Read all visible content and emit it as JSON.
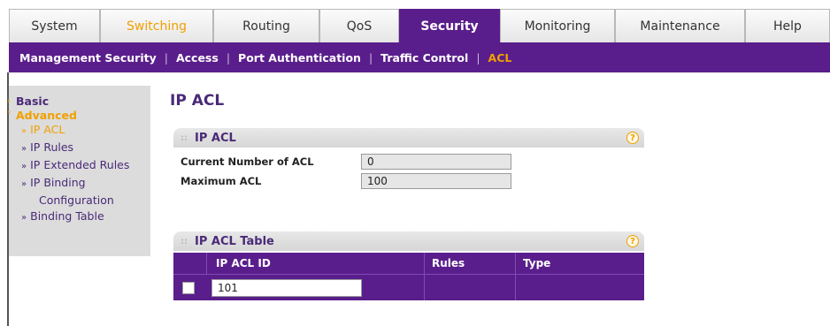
{
  "tabs": [
    {
      "label": "System",
      "style": "normal"
    },
    {
      "label": "Switching",
      "style": "orange"
    },
    {
      "label": "Routing",
      "style": "normal"
    },
    {
      "label": "QoS",
      "style": "normal"
    },
    {
      "label": "Security",
      "style": "active"
    },
    {
      "label": "Monitoring",
      "style": "normal"
    },
    {
      "label": "Maintenance",
      "style": "normal"
    },
    {
      "label": "Help",
      "style": "normal"
    }
  ],
  "subnav": {
    "items": [
      "Management Security",
      "Access",
      "Port Authentication",
      "Traffic Control",
      "ACL"
    ],
    "active_index": 4
  },
  "sidebar": {
    "basic": "Basic",
    "advanced": "Advanced",
    "items": [
      {
        "label": "IP ACL",
        "active": true
      },
      {
        "label": "IP Rules",
        "active": false
      },
      {
        "label": "IP Extended Rules",
        "active": false
      },
      {
        "label": "IP Binding",
        "active": false
      },
      {
        "label": "Configuration",
        "active": false
      },
      {
        "label": "Binding Table",
        "active": false
      }
    ]
  },
  "page": {
    "title": "IP ACL"
  },
  "ip_acl_panel": {
    "title": "IP ACL",
    "rows": [
      {
        "label": "Current Number of ACL",
        "value": "0"
      },
      {
        "label": "Maximum ACL",
        "value": "100"
      }
    ]
  },
  "table_panel": {
    "title": "IP ACL Table",
    "columns": [
      "IP ACL ID",
      "Rules",
      "Type"
    ],
    "row": {
      "id_value": "101",
      "rules": "",
      "type": ""
    }
  },
  "colors": {
    "accent": "#5a1e8c",
    "highlight": "#f0a000"
  }
}
